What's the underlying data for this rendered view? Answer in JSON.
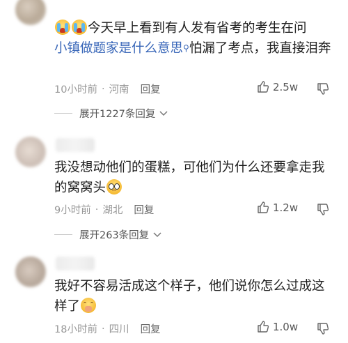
{
  "comments": [
    {
      "text_after_emoji": "今天早上看到有人发有省考的考生在问",
      "link_text": "小镇做题家是什么意思",
      "text_after_link": "怕漏了考点，我直接泪奔",
      "time": "10小时前",
      "location": "河南",
      "reply_label": "回复",
      "likes": "2.5w",
      "expand_label": "展开1227条回复",
      "emoji": [
        "loudly-crying-face",
        "loudly-crying-face"
      ]
    },
    {
      "text": "我没想动他们的蛋糕，可他们为什么还要拿走我的窝窝头",
      "time": "9小时前",
      "location": "湖北",
      "reply_label": "回复",
      "likes": "1.2w",
      "expand_label": "展开263条回复",
      "emoji": [
        "worried-face"
      ]
    },
    {
      "text": "我好不容易活成这个样子，他们说你怎么过成这样了",
      "time": "18小时前",
      "location": "四川",
      "reply_label": "回复",
      "likes": "1.0w",
      "emoji": [
        "face-holding-back-tears"
      ]
    }
  ]
}
